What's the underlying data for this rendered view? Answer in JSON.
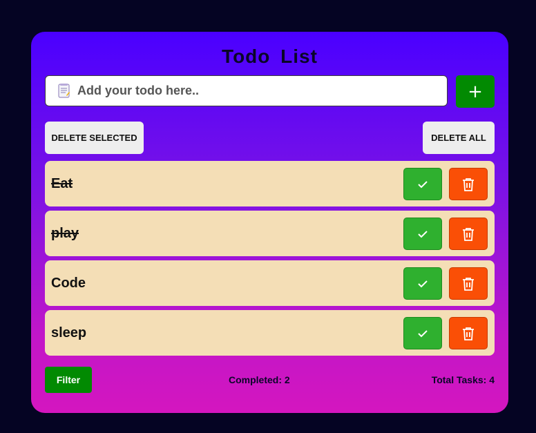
{
  "app": {
    "title": "Todo  List"
  },
  "input": {
    "placeholder": "Add your todo here..",
    "value": "",
    "icon": "notepad-icon"
  },
  "add_button": {
    "label": "+",
    "color": "#028a02"
  },
  "actions": {
    "delete_selected_label": "DELETE SELECTED",
    "delete_all_label": "DELETE ALL"
  },
  "todos": [
    {
      "text": "Eat",
      "completed": true
    },
    {
      "text": "play",
      "completed": true
    },
    {
      "text": "Code",
      "completed": false
    },
    {
      "text": "sleep",
      "completed": false
    }
  ],
  "footer": {
    "filter_label": "Filter",
    "completed_text": "Completed: 2",
    "total_text": "Total Tasks: 4"
  },
  "colors": {
    "background": "#050423",
    "gradient_top": "#4a00ff",
    "gradient_bottom": "#d416bf",
    "todo_row": "#f4deb6",
    "check_button": "#2fb02f",
    "delete_button": "#fa4f06",
    "filter_button": "#028a02"
  }
}
